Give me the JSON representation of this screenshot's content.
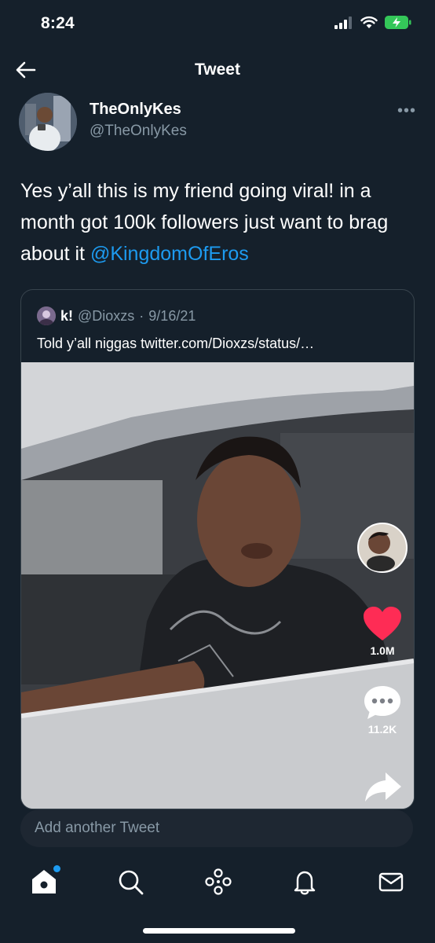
{
  "status_bar": {
    "time": "8:24",
    "signal_icon": "signal-icon",
    "wifi_icon": "wifi-icon",
    "battery_icon": "battery-charging-icon"
  },
  "nav": {
    "title": "Tweet",
    "back_icon": "back-arrow-icon"
  },
  "tweet": {
    "author_name": "TheOnlyKes",
    "author_handle": "@TheOnlyKes",
    "more_icon": "more-icon",
    "text": "Yes y’all this is my friend going viral! in a month got 100k followers just want to brag about it ",
    "mention": "@KingdomOfEros"
  },
  "quote": {
    "name": "k!",
    "handle": "@Dioxzs",
    "sep": "·",
    "date": "9/16/21",
    "text": "Told y’all niggas twitter.com/Dioxzs/status/…",
    "likes": "1.0M",
    "comments": "11.2K"
  },
  "compose": {
    "placeholder": "Add another Tweet"
  },
  "tabbar": {
    "icons": [
      "home-icon",
      "search-icon",
      "spaces-icon",
      "notifications-icon",
      "messages-icon"
    ]
  },
  "colors": {
    "background": "#15202b",
    "accent": "#1d9bf0",
    "secondary_text": "#8899a6",
    "border": "#38444d",
    "like": "#fe2c55"
  }
}
